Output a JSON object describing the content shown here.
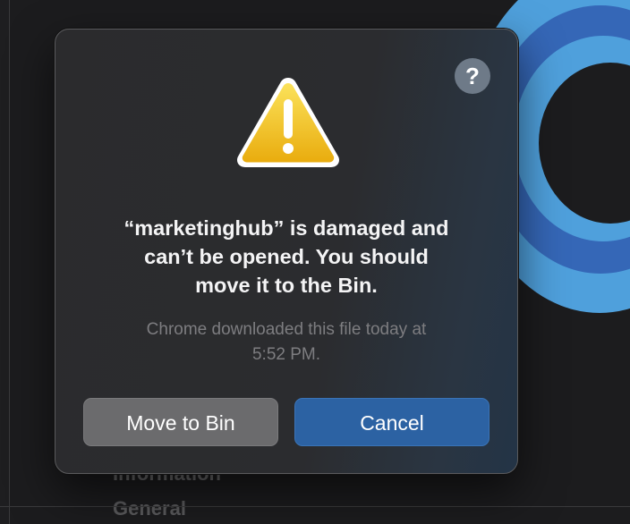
{
  "background": {
    "label_1": "Information",
    "label_2": "General"
  },
  "dialog": {
    "help_label": "?",
    "icon": "warning-icon",
    "title_lines": [
      "“marketinghub” is damaged and",
      "can’t be opened. You should",
      "move it to the Bin."
    ],
    "message_lines": [
      "Chrome downloaded this file today at",
      "5:52 PM."
    ],
    "buttons": {
      "move_to_bin": "Move to Bin",
      "cancel": "Cancel"
    }
  },
  "colors": {
    "warning_yellow": "#f2c21b",
    "primary_button": "#2c62a3",
    "secondary_button": "#6b6b6d"
  }
}
